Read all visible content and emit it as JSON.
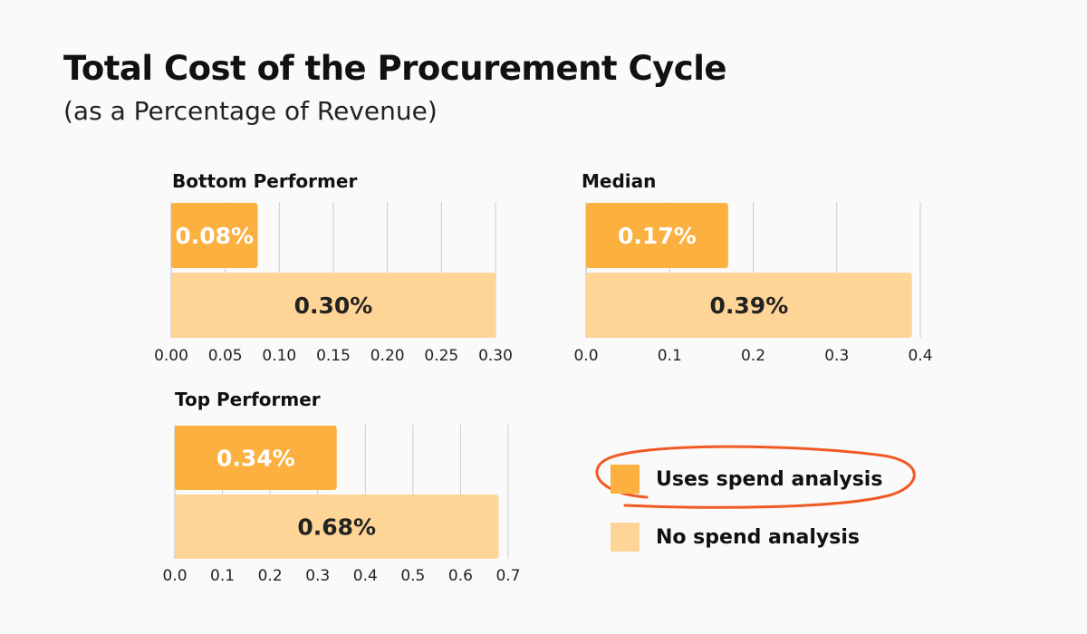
{
  "title": "Total Cost of the Procurement Cycle",
  "subtitle": "(as a Percentage of Revenue)",
  "colors": {
    "uses": "#fbb040",
    "no": "#fed597",
    "grid": "#cccccc",
    "highlight": "#f05a24"
  },
  "legend": [
    {
      "label": "Uses spend analysis",
      "color": "#fbb040",
      "highlighted": true
    },
    {
      "label": "No spend analysis",
      "color": "#fed597",
      "highlighted": false
    }
  ],
  "chart_data": [
    {
      "type": "bar",
      "orientation": "horizontal",
      "title": "Bottom Performer",
      "series": [
        {
          "name": "Uses spend analysis",
          "values": [
            0.08
          ],
          "labels": [
            "0.08%"
          ]
        },
        {
          "name": "No spend analysis",
          "values": [
            0.3
          ],
          "labels": [
            "0.30%"
          ]
        }
      ],
      "xlim": [
        0,
        0.3
      ],
      "ticks": [
        0,
        0.05,
        0.1,
        0.15,
        0.2,
        0.25,
        0.3
      ],
      "tick_labels": [
        "0.00",
        "0.05",
        "0.10",
        "0.15",
        "0.20",
        "0.25",
        "0.30"
      ],
      "grid": true
    },
    {
      "type": "bar",
      "orientation": "horizontal",
      "title": "Median",
      "series": [
        {
          "name": "Uses spend analysis",
          "values": [
            0.17
          ],
          "labels": [
            "0.17%"
          ]
        },
        {
          "name": "No spend analysis",
          "values": [
            0.39
          ],
          "labels": [
            "0.39%"
          ]
        }
      ],
      "xlim": [
        0,
        0.4
      ],
      "ticks": [
        0,
        0.1,
        0.2,
        0.3,
        0.4
      ],
      "tick_labels": [
        "0.0",
        "0.1",
        "0.2",
        "0.3",
        "0.4"
      ],
      "grid": true
    },
    {
      "type": "bar",
      "orientation": "horizontal",
      "title": "Top Performer",
      "series": [
        {
          "name": "Uses spend analysis",
          "values": [
            0.34
          ],
          "labels": [
            "0.34%"
          ]
        },
        {
          "name": "No spend analysis",
          "values": [
            0.68
          ],
          "labels": [
            "0.68%"
          ]
        }
      ],
      "xlim": [
        0,
        0.7
      ],
      "ticks": [
        0,
        0.1,
        0.2,
        0.3,
        0.4,
        0.5,
        0.6,
        0.7
      ],
      "tick_labels": [
        "0.0",
        "0.1",
        "0.2",
        "0.3",
        "0.4",
        "0.5",
        "0.6",
        "0.7"
      ],
      "grid": true
    }
  ]
}
